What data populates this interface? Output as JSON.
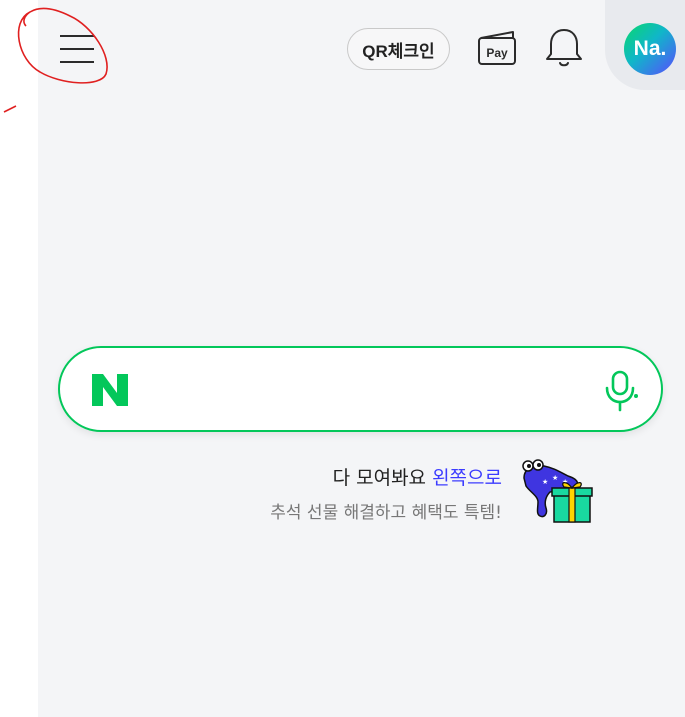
{
  "header": {
    "menu_icon": "hamburger-menu-icon",
    "qr_checkin_label": "QR체크인",
    "pay_label": "Pay",
    "notification_icon": "bell-icon",
    "avatar_text": "Na."
  },
  "search": {
    "logo_letter": "N",
    "placeholder": "",
    "mic_icon": "microphone-icon",
    "accent_color": "#03c75a"
  },
  "promo": {
    "line1_prefix": "다 모여봐요 ",
    "line1_highlight": "왼쪽으로",
    "line2": "추석 선물 해결하고 혜택도 특템!",
    "highlight_color": "#3c3cff",
    "icon": "gift-character-icon"
  }
}
